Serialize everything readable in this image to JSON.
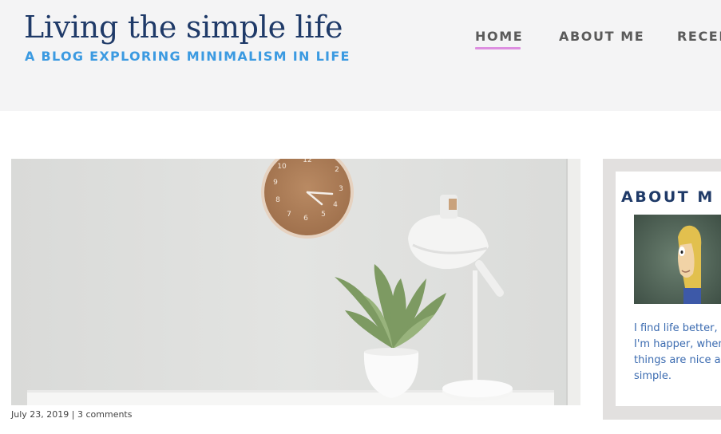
{
  "site": {
    "title": "Living the simple life",
    "tagline": "A BLOG EXPLORING MINIMALISM IN LIFE"
  },
  "nav": {
    "items": [
      {
        "label": "HOME",
        "active": true
      },
      {
        "label": "ABOUT ME",
        "active": false
      },
      {
        "label": "RECEN",
        "active": false
      }
    ]
  },
  "post": {
    "date": "July 23, 2019",
    "separator": "|",
    "comments": "3 comments",
    "image_icon": "hero-photo-desk-clock-lamp-plant"
  },
  "sidebar": {
    "widget_title": "ABOUT M",
    "bio_lines": [
      "I find life better,",
      "I'm happer, when",
      "things are nice ar",
      "simple."
    ]
  },
  "colors": {
    "title": "#1f3a68",
    "tagline": "#3b9ae1",
    "nav_text": "#5a5a5a",
    "nav_underline": "#dd8fe0",
    "header_bg": "#f4f4f5",
    "sidebar_bg": "#e2e0df",
    "bio_text": "#3b6bb0"
  }
}
